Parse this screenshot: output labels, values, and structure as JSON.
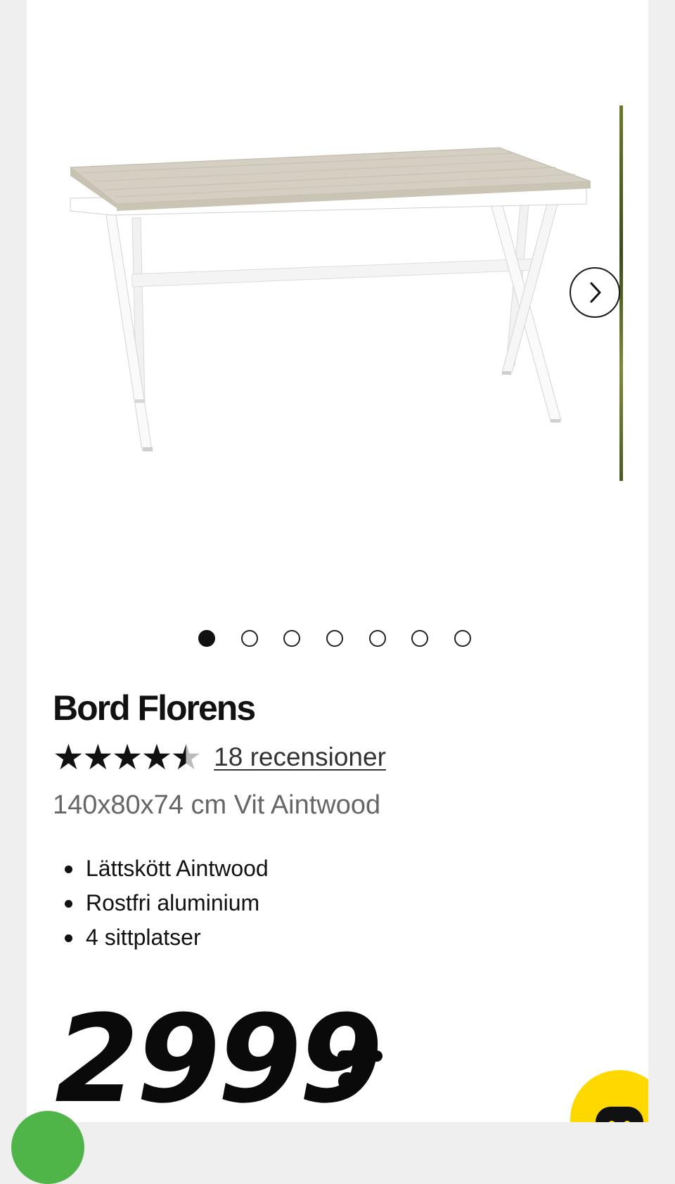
{
  "product": {
    "title": "Bord Florens",
    "rating": 4.5,
    "rating_max": 5,
    "reviews_label": "18 recensioner",
    "variant": "140x80x74 cm Vit Aintwood",
    "features": [
      "Lättskött Aintwood",
      "Rostfri aluminium",
      "4 sittplatser"
    ],
    "price": "2999"
  },
  "gallery": {
    "image_count": 7,
    "active_index": 0,
    "next_icon": "chevron-right-icon"
  },
  "colors": {
    "accent_yellow": "#ffd800",
    "green": "#4fb548",
    "text": "#111111",
    "muted": "#666666"
  }
}
